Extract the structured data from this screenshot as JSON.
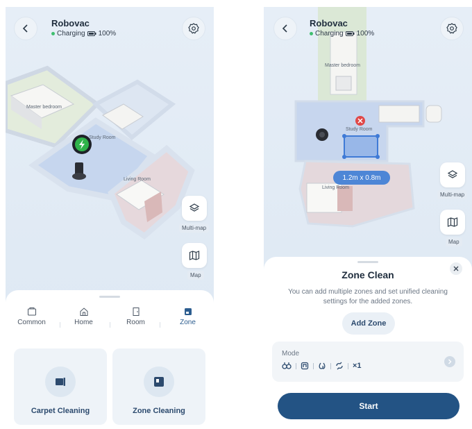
{
  "left": {
    "header": {
      "title": "Robovac",
      "status": "Charging",
      "battery": "100%"
    },
    "rooms": {
      "master": "Master bedroom",
      "study": "Study Room",
      "living": "Living Room"
    },
    "side": {
      "multimap": "Multi-map",
      "map": "Map"
    },
    "tabs": [
      {
        "label": "Common",
        "icon": "card-icon",
        "active": false
      },
      {
        "label": "Home",
        "icon": "home-icon",
        "active": false
      },
      {
        "label": "Room",
        "icon": "door-icon",
        "active": false
      },
      {
        "label": "Zone",
        "icon": "zone-icon",
        "active": true
      }
    ],
    "cards": [
      {
        "label": "Carpet Cleaning",
        "icon": "carpet-icon"
      },
      {
        "label": "Zone Cleaning",
        "icon": "zone-cleaning-icon"
      }
    ]
  },
  "right": {
    "header": {
      "title": "Robovac",
      "status": "Charging",
      "battery": "100%"
    },
    "rooms": {
      "master": "Master bedroom",
      "study": "Study Room",
      "living": "Living Room"
    },
    "zone_size": "1.2m x 0.8m",
    "side": {
      "multimap": "Multi-map",
      "map": "Map"
    },
    "sheet": {
      "title": "Zone Clean",
      "description": "You can add multiple zones and set unified cleaning settings for the added zones.",
      "add_zone": "Add Zone",
      "mode_label": "Mode",
      "mode_count": "×1",
      "start": "Start"
    }
  },
  "colors": {
    "accent": "#235384",
    "zone": "#4d86d6",
    "charging": "#3fbf6f",
    "charger_badge": "#2fb34a"
  }
}
